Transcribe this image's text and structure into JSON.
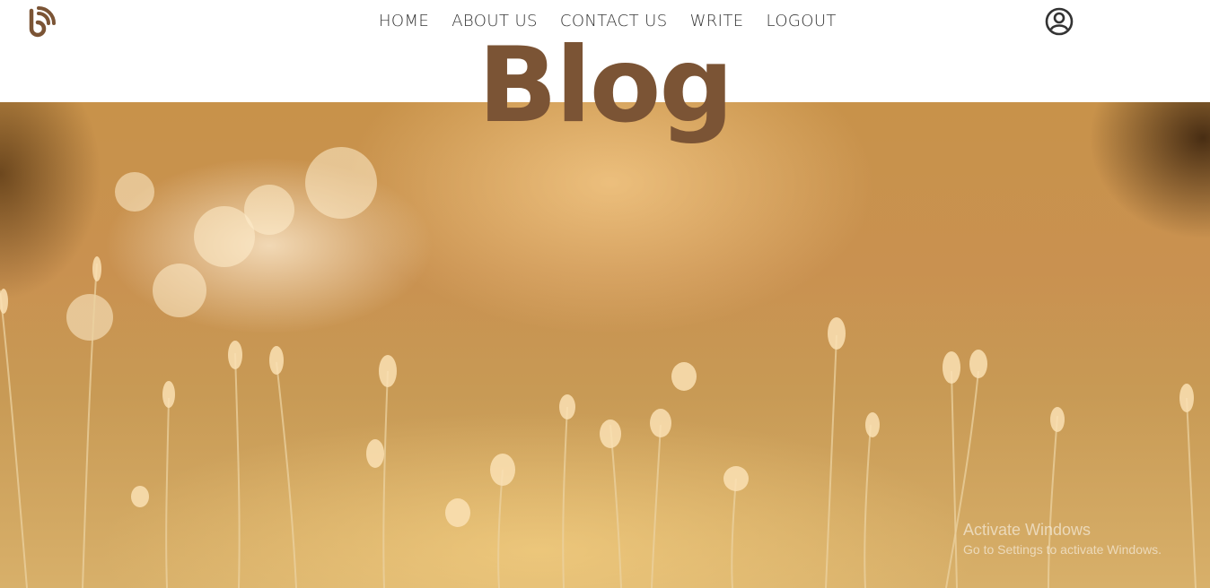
{
  "header": {
    "logo_icon": "blog-rss-logo-icon",
    "nav": [
      {
        "label": "HOME"
      },
      {
        "label": "ABOUT US"
      },
      {
        "label": "CONTACT US"
      },
      {
        "label": "WRITE"
      },
      {
        "label": "LOGOUT"
      }
    ],
    "profile_icon": "user-circle-icon"
  },
  "hero": {
    "title": "Blog",
    "image_icon": "grass-field-photo"
  },
  "watermark": {
    "line1": "Activate Windows",
    "line2": "Go to Settings to activate Windows."
  },
  "colors": {
    "brand": "#7b5435",
    "nav_text": "#333333",
    "header_bg": "#ffffff"
  }
}
